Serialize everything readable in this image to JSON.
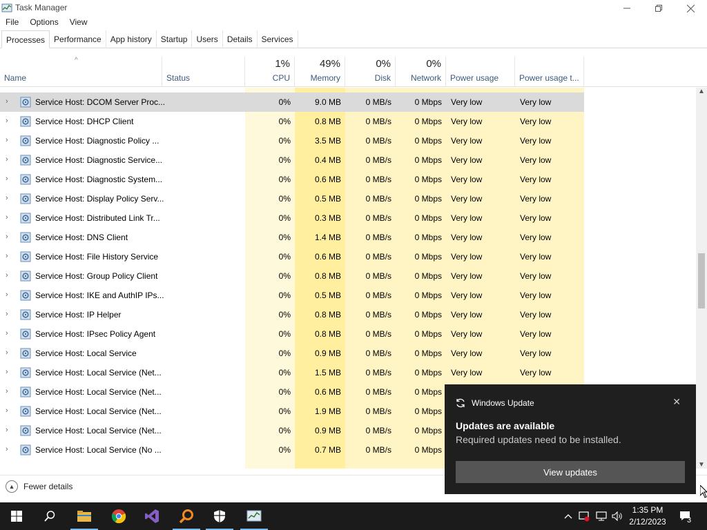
{
  "window": {
    "title": "Task Manager"
  },
  "menu": [
    "File",
    "Options",
    "View"
  ],
  "tabs": [
    "Processes",
    "Performance",
    "App history",
    "Startup",
    "Users",
    "Details",
    "Services"
  ],
  "columns": {
    "name": "Name",
    "status": "Status",
    "cpu": {
      "pct": "1%",
      "label": "CPU"
    },
    "memory": {
      "pct": "49%",
      "label": "Memory"
    },
    "disk": {
      "pct": "0%",
      "label": "Disk"
    },
    "network": {
      "pct": "0%",
      "label": "Network"
    },
    "power": "Power usage",
    "power_trend": "Power usage t..."
  },
  "rows": [
    {
      "name": "Service Host: DCOM Server Proc...",
      "cpu": "0%",
      "mem": "9.0 MB",
      "disk": "0 MB/s",
      "net": "0 Mbps",
      "pw": "Very low",
      "pwt": "Very low"
    },
    {
      "name": "Service Host: DHCP Client",
      "cpu": "0%",
      "mem": "0.8 MB",
      "disk": "0 MB/s",
      "net": "0 Mbps",
      "pw": "Very low",
      "pwt": "Very low"
    },
    {
      "name": "Service Host: Diagnostic Policy ...",
      "cpu": "0%",
      "mem": "3.5 MB",
      "disk": "0 MB/s",
      "net": "0 Mbps",
      "pw": "Very low",
      "pwt": "Very low"
    },
    {
      "name": "Service Host: Diagnostic Service...",
      "cpu": "0%",
      "mem": "0.4 MB",
      "disk": "0 MB/s",
      "net": "0 Mbps",
      "pw": "Very low",
      "pwt": "Very low"
    },
    {
      "name": "Service Host: Diagnostic System...",
      "cpu": "0%",
      "mem": "0.6 MB",
      "disk": "0 MB/s",
      "net": "0 Mbps",
      "pw": "Very low",
      "pwt": "Very low"
    },
    {
      "name": "Service Host: Display Policy Serv...",
      "cpu": "0%",
      "mem": "0.5 MB",
      "disk": "0 MB/s",
      "net": "0 Mbps",
      "pw": "Very low",
      "pwt": "Very low"
    },
    {
      "name": "Service Host: Distributed Link Tr...",
      "cpu": "0%",
      "mem": "0.3 MB",
      "disk": "0 MB/s",
      "net": "0 Mbps",
      "pw": "Very low",
      "pwt": "Very low"
    },
    {
      "name": "Service Host: DNS Client",
      "cpu": "0%",
      "mem": "1.4 MB",
      "disk": "0 MB/s",
      "net": "0 Mbps",
      "pw": "Very low",
      "pwt": "Very low"
    },
    {
      "name": "Service Host: File History Service",
      "cpu": "0%",
      "mem": "0.6 MB",
      "disk": "0 MB/s",
      "net": "0 Mbps",
      "pw": "Very low",
      "pwt": "Very low"
    },
    {
      "name": "Service Host: Group Policy Client",
      "cpu": "0%",
      "mem": "0.8 MB",
      "disk": "0 MB/s",
      "net": "0 Mbps",
      "pw": "Very low",
      "pwt": "Very low"
    },
    {
      "name": "Service Host: IKE and AuthIP IPs...",
      "cpu": "0%",
      "mem": "0.5 MB",
      "disk": "0 MB/s",
      "net": "0 Mbps",
      "pw": "Very low",
      "pwt": "Very low"
    },
    {
      "name": "Service Host: IP Helper",
      "cpu": "0%",
      "mem": "0.8 MB",
      "disk": "0 MB/s",
      "net": "0 Mbps",
      "pw": "Very low",
      "pwt": "Very low"
    },
    {
      "name": "Service Host: IPsec Policy Agent",
      "cpu": "0%",
      "mem": "0.8 MB",
      "disk": "0 MB/s",
      "net": "0 Mbps",
      "pw": "Very low",
      "pwt": "Very low"
    },
    {
      "name": "Service Host: Local Service",
      "cpu": "0%",
      "mem": "0.9 MB",
      "disk": "0 MB/s",
      "net": "0 Mbps",
      "pw": "Very low",
      "pwt": "Very low"
    },
    {
      "name": "Service Host: Local Service (Net...",
      "cpu": "0%",
      "mem": "1.5 MB",
      "disk": "0 MB/s",
      "net": "0 Mbps",
      "pw": "Very low",
      "pwt": "Very low"
    },
    {
      "name": "Service Host: Local Service (Net...",
      "cpu": "0%",
      "mem": "0.6 MB",
      "disk": "0 MB/s",
      "net": "0 Mbps",
      "pw": "",
      "pwt": ""
    },
    {
      "name": "Service Host: Local Service (Net...",
      "cpu": "0%",
      "mem": "1.9 MB",
      "disk": "0 MB/s",
      "net": "0 Mbps",
      "pw": "",
      "pwt": ""
    },
    {
      "name": "Service Host: Local Service (Net...",
      "cpu": "0%",
      "mem": "0.9 MB",
      "disk": "0 MB/s",
      "net": "0 Mbps",
      "pw": "",
      "pwt": ""
    },
    {
      "name": "Service Host: Local Service (No ...",
      "cpu": "0%",
      "mem": "0.7 MB",
      "disk": "0 MB/s",
      "net": "0 Mbps",
      "pw": "",
      "pwt": ""
    }
  ],
  "footer": {
    "fewer_details": "Fewer details"
  },
  "toast": {
    "app": "Windows Update",
    "title": "Updates are available",
    "body": "Required updates need to be installed.",
    "button": "View updates"
  },
  "taskbar": {
    "time": "1:35 PM",
    "date": "2/12/2023",
    "notification_count": "3",
    "accent": "#76b9ed"
  },
  "colors": {
    "selected_row": "#dadada",
    "memory_heat": "#ffef9f",
    "cell_heat": "#fff4c4",
    "toast_bg": "#1f1f1f"
  }
}
